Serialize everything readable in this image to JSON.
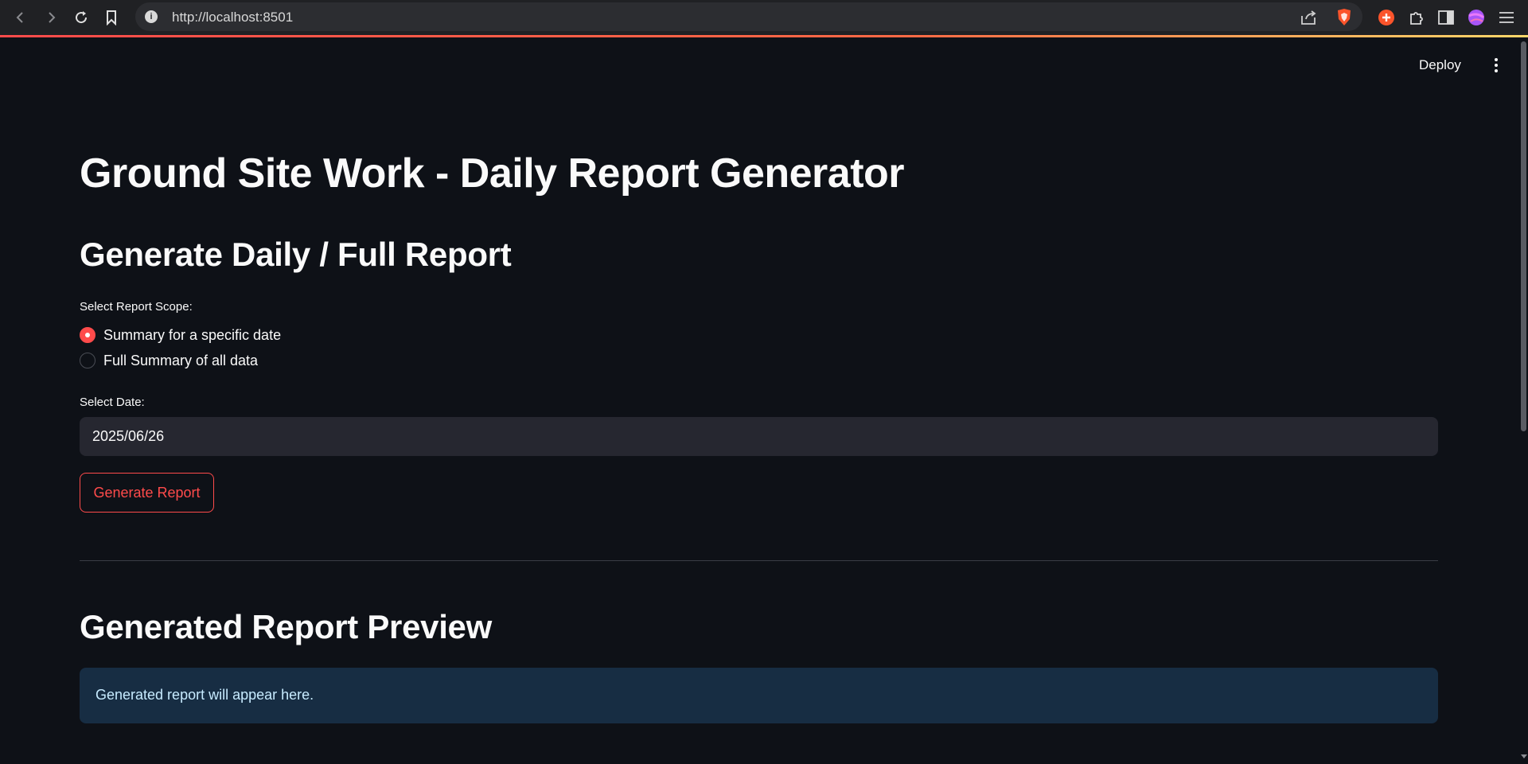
{
  "browser": {
    "url": "http://localhost:8501",
    "icons": [
      "back-icon",
      "forward-icon",
      "reload-icon",
      "bookmark-icon",
      "info-icon",
      "share-icon",
      "brave-shield-icon",
      "brave-rewards-icon",
      "extensions-icon",
      "sidebar-icon",
      "profile-icon",
      "menu-icon"
    ]
  },
  "header": {
    "deploy_label": "Deploy",
    "menu_icon": "kebab-menu-icon"
  },
  "page": {
    "title": "Ground Site Work - Daily Report Generator",
    "section_generate": "Generate Daily / Full Report",
    "scope_label": "Select Report Scope:",
    "scope_options": [
      {
        "label": "Summary for a specific date",
        "selected": true
      },
      {
        "label": "Full Summary of all data",
        "selected": false
      }
    ],
    "date_label": "Select Date:",
    "date_value": "2025/06/26",
    "generate_button": "Generate Report",
    "section_preview": "Generated Report Preview",
    "preview_message": "Generated report will appear here."
  },
  "colors": {
    "background": "#0e1117",
    "accent": "#ff4b4b",
    "input_bg": "#262730",
    "info_bg": "#172d43",
    "info_text": "#c7ebff"
  }
}
